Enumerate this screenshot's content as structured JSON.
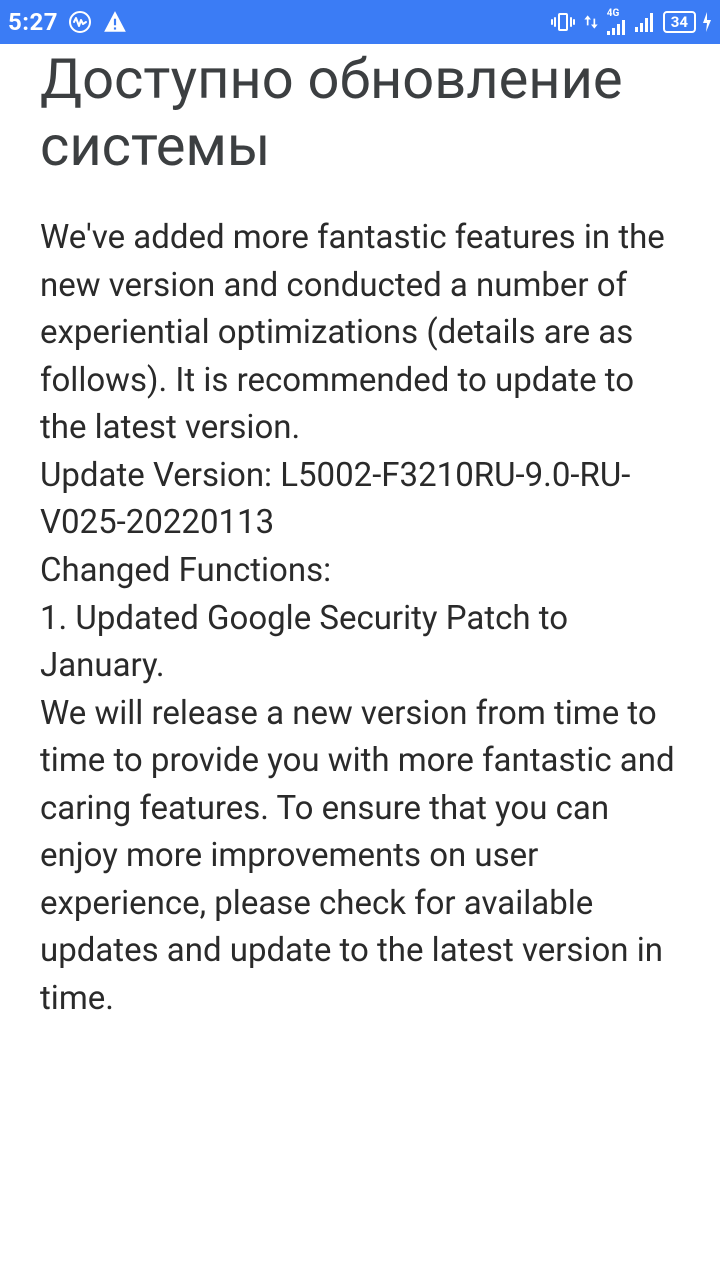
{
  "statusbar": {
    "time": "5:27",
    "network_label": "4G",
    "battery_percent": "34"
  },
  "page": {
    "title": "Доступно обновление системы",
    "intro": "We've added more fantastic features in the new version and conducted a number of experiential optimizations (details are as follows). It is recommended to update to the latest version.",
    "version_line": "Update Version: L5002-F3210RU-9.0-RU-V025-20220113",
    "changed_label": "Changed Functions:",
    "change1": "1. Updated Google Security Patch to January.",
    "outro": "We will release a new version from time to time to provide you with more fantastic and caring features. To ensure that you can enjoy more improvements on user experience, please check for available updates and update to the latest version in time."
  }
}
